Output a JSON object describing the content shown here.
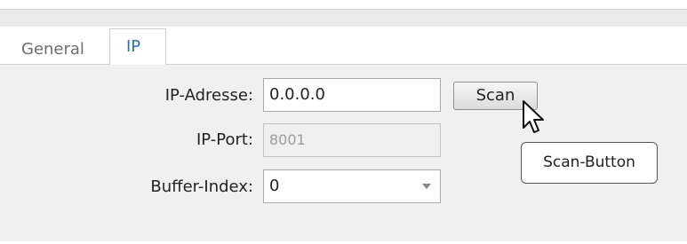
{
  "tabs": {
    "general_label": "General",
    "ip_label": "IP"
  },
  "form": {
    "ip_address_label": "IP-Adresse:",
    "ip_address_value": "0.0.0.0",
    "ip_port_label": "IP-Port:",
    "ip_port_value": "8001",
    "buffer_index_label": "Buffer-Index:",
    "buffer_index_value": "0"
  },
  "scan_button": {
    "label": "Scan"
  },
  "tooltip": {
    "text": "Scan-Button"
  },
  "colors": {
    "active_tab_text": "#2e6fb6",
    "panel_bg": "#f0f0f0"
  }
}
